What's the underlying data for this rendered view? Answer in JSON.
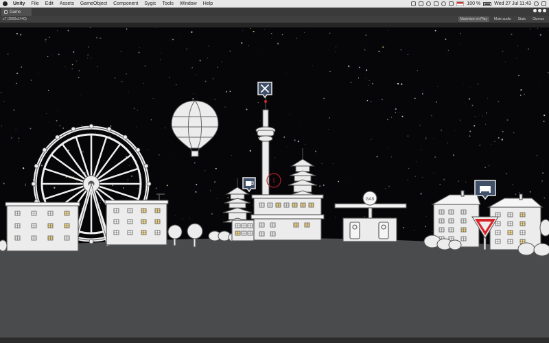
{
  "menubar": {
    "app_name": "Unity",
    "items": [
      "File",
      "Edit",
      "Assets",
      "GameObject",
      "Component",
      "Sygic",
      "Tools",
      "Window",
      "Help"
    ],
    "battery": "100 %",
    "datetime": "Wed 27 Jul  11:43"
  },
  "window": {
    "tab_label": "Game",
    "resolution": "x7 (2560x1440)"
  },
  "toolbar": {
    "maximize_on_play": "Maximize on Play",
    "mute_audio": "Mute audio",
    "stats": "Stats",
    "gizmos": "Gizmos"
  },
  "scene": {
    "gas_sign": "GAS",
    "colors": {
      "sky": "#060608",
      "ground": "#4a4b4d",
      "building_fill": "#ececec",
      "outline": "#555555",
      "lit_window": "#f3d98a",
      "poi_pin": "#3f5068",
      "yield_red": "#d8232a"
    },
    "poi_icons": [
      "wrench-screwdriver-icon",
      "coffee-cup-icon",
      "bed-icon"
    ]
  }
}
